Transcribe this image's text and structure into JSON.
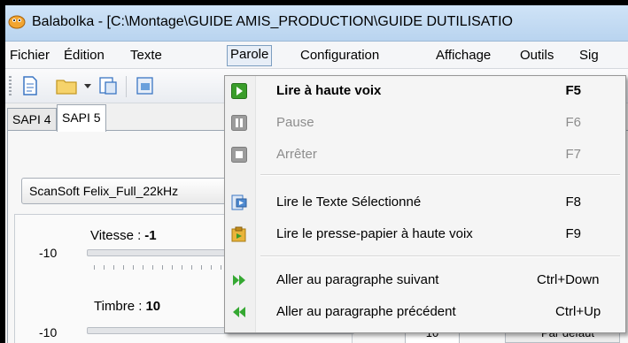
{
  "window": {
    "title": "Balabolka - [C:\\Montage\\GUIDE AMIS_PRODUCTION\\GUIDE DUTILISATIO"
  },
  "menubar": {
    "items": [
      {
        "label": "Fichier"
      },
      {
        "label": "Édition"
      },
      {
        "label": "Texte"
      },
      {
        "label": "Parole"
      },
      {
        "label": "Configuration"
      },
      {
        "label": "Affichage"
      },
      {
        "label": "Outils"
      },
      {
        "label": "Sig"
      }
    ]
  },
  "toolbar": {
    "icons": [
      "new-document-icon",
      "open-folder-icon",
      "dropdown-arrow-icon",
      "save-icon",
      "save-audio-icon"
    ]
  },
  "tabs": [
    {
      "label": "SAPI 4"
    },
    {
      "label": "SAPI 5"
    }
  ],
  "voice": {
    "selected": "ScanSoft Felix_Full_22kHz"
  },
  "sliders": {
    "speed": {
      "label": "Vitesse :",
      "value": "-1",
      "min": "-10"
    },
    "pitch": {
      "label": "Timbre :",
      "value": "10",
      "min": "-10"
    }
  },
  "right_panel": {
    "value_box": "10",
    "default_label": "Par défaut"
  },
  "parole_menu": {
    "items": [
      {
        "label": "Lire à haute voix",
        "shortcut": "F5",
        "icon": "play-icon",
        "bold": true,
        "disabled": false
      },
      {
        "label": "Pause",
        "shortcut": "F6",
        "icon": "pause-icon",
        "bold": false,
        "disabled": true
      },
      {
        "label": "Arrêter",
        "shortcut": "F7",
        "icon": "stop-icon",
        "bold": false,
        "disabled": true
      },
      {
        "label": "Lire le Texte Sélectionné",
        "shortcut": "F8",
        "icon": "read-selection-icon",
        "bold": false,
        "disabled": false
      },
      {
        "label": "Lire le presse-papier à haute voix",
        "shortcut": "F9",
        "icon": "clipboard-icon",
        "bold": false,
        "disabled": false
      },
      {
        "label": "Aller au paragraphe suivant",
        "shortcut": "Ctrl+Down",
        "icon": "next-paragraph-icon",
        "bold": false,
        "disabled": false
      },
      {
        "label": "Aller au paragraphe précédent",
        "shortcut": "Ctrl+Up",
        "icon": "previous-paragraph-icon",
        "bold": false,
        "disabled": false
      }
    ]
  },
  "colors": {
    "play_green": "#3a9d2a",
    "disabled_gray": "#8d8d8d",
    "arrow_green": "#35a832"
  }
}
